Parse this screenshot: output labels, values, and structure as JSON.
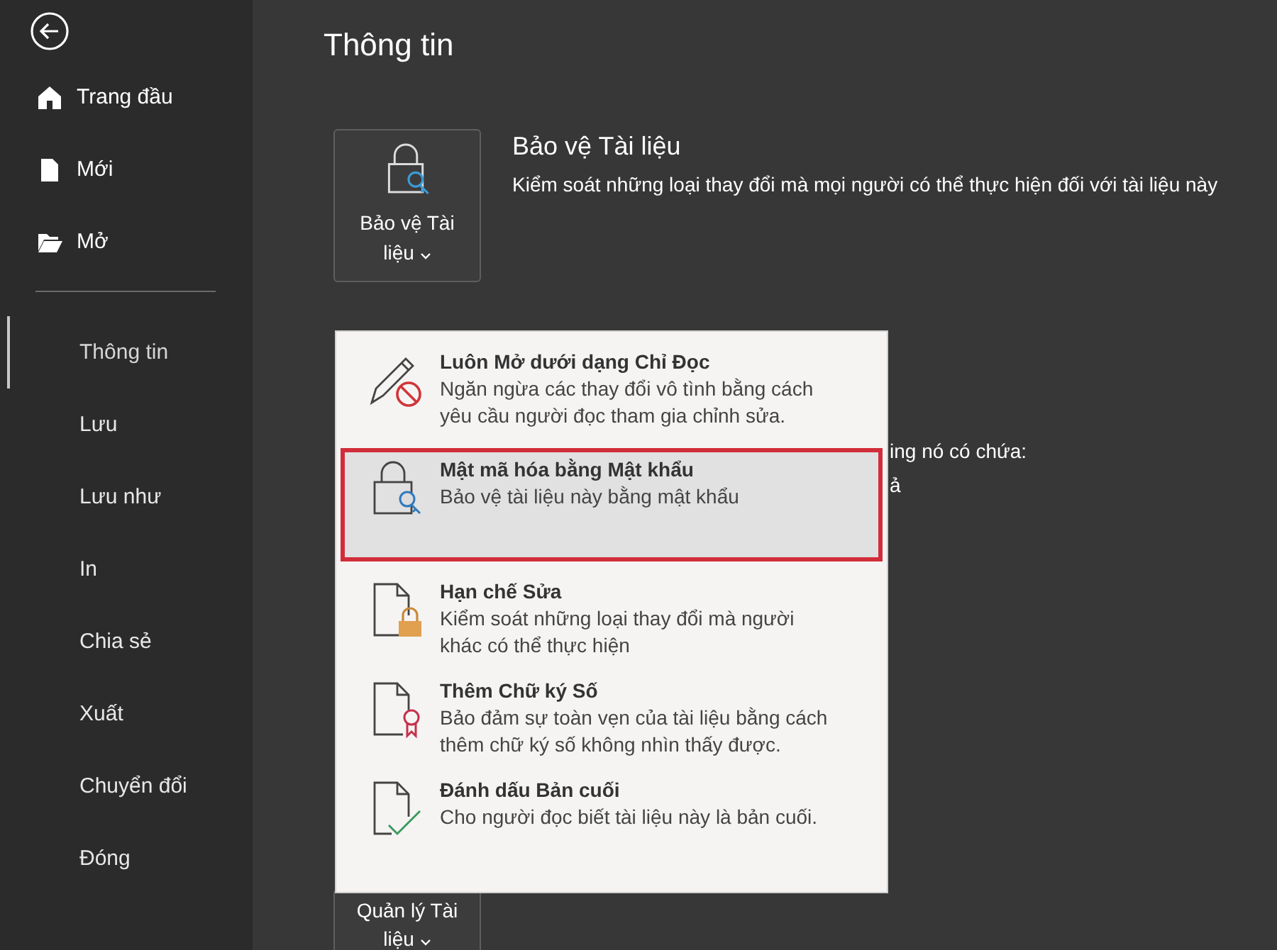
{
  "sidebar": {
    "top_items": [
      {
        "label": "Trang đầu",
        "kind": "home"
      },
      {
        "label": "Mới",
        "kind": "new"
      },
      {
        "label": "Mở",
        "kind": "open"
      }
    ],
    "items": [
      {
        "label": "Thông tin",
        "selected": true
      },
      {
        "label": "Lưu",
        "selected": false
      },
      {
        "label": "Lưu như",
        "selected": false
      },
      {
        "label": "In",
        "selected": false
      },
      {
        "label": "Chia sẻ",
        "selected": false
      },
      {
        "label": "Xuất",
        "selected": false
      },
      {
        "label": "Chuyển đổi",
        "selected": false
      },
      {
        "label": "Đóng",
        "selected": false
      }
    ]
  },
  "page_title": "Thông tin",
  "sections": [
    {
      "button": "Bảo vệ Tài liệu",
      "kind": "protect",
      "heading": "Bảo vệ Tài liệu",
      "description": "Kiểm soát những loại thay đổi mà mọi người có thể thực hiện đối với tài liệu này"
    },
    {
      "button": "Quản lý Tài liệu",
      "kind": "manage"
    }
  ],
  "hidden_text": [
    "ing nó có chứa:",
    "ả"
  ],
  "menu": [
    {
      "kind": "read_only",
      "title": "Luôn Mở dưới dạng Chỉ Đọc",
      "description": "Ngăn ngừa các thay đổi vô tình bằng cách yêu cầu người đọc tham gia chỉnh sửa.",
      "selected": false
    },
    {
      "kind": "encrypt",
      "title": "Mật mã hóa bằng Mật khẩu",
      "description": "Bảo vệ tài liệu này bằng mật khẩu",
      "selected": true
    },
    {
      "kind": "restrict",
      "title": "Hạn chế Sửa",
      "description": "Kiểm soát những loại thay đổi mà người khác có thể thực hiện",
      "selected": false
    },
    {
      "kind": "signature",
      "title": "Thêm Chữ ký Số",
      "description": "Bảo đảm sự toàn vẹn của tài liệu bằng cách thêm chữ ký số không nhìn thấy được.",
      "selected": false
    },
    {
      "kind": "final",
      "title": "Đánh dấu Bản cuối",
      "description": "Cho người đọc biết tài liệu này là bản cuối.",
      "selected": false
    }
  ]
}
